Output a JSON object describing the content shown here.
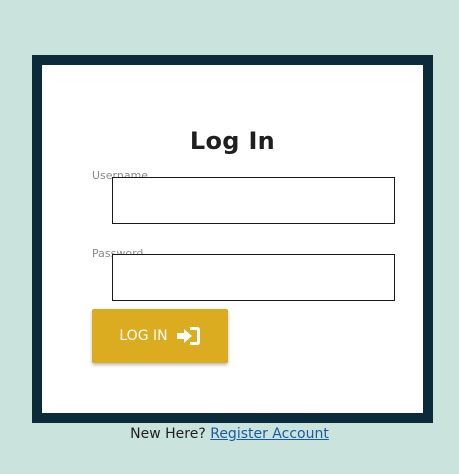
{
  "login": {
    "title": "Log In",
    "username_label": "Username",
    "username_value": "",
    "password_label": "Password",
    "password_value": "",
    "submit_label": "LOG IN",
    "submit_icon": "sign-in-icon"
  },
  "footer": {
    "prompt": "New Here?",
    "register_link": "Register Account"
  },
  "colors": {
    "page_background": "#cae3dc",
    "frame": "#0b2b3a",
    "button": "#dbab20",
    "link": "#1a5aa0"
  }
}
